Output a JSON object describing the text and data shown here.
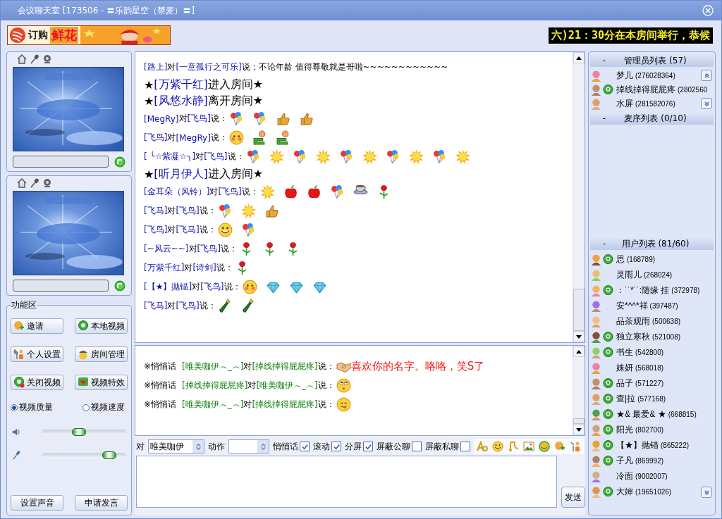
{
  "window": {
    "title": "会议聊天室 [173506 - 〓乐韵星空（禁麦）〓]"
  },
  "banner": {
    "text": "订购",
    "highlight": "鲜花"
  },
  "marquee": {
    "text": "六)21：30分在本房间举行，恭候"
  },
  "function_area": {
    "title": "功能区",
    "buttons": [
      {
        "label": "邀请",
        "kind": "invite"
      },
      {
        "label": "本地视频",
        "kind": "local_video"
      },
      {
        "label": "个人设置",
        "kind": "settings"
      },
      {
        "label": "房间管理",
        "kind": "room"
      },
      {
        "label": "关闭视频",
        "kind": "close_video"
      },
      {
        "label": "视频特效",
        "kind": "effect"
      }
    ],
    "radios": [
      {
        "label": "视频质量",
        "selected": true
      },
      {
        "label": "视频速度",
        "selected": false
      }
    ],
    "sliders": [
      {
        "kind": "speaker",
        "level": 0.42
      },
      {
        "kind": "mic",
        "level": 0.86
      }
    ],
    "bottom_buttons": [
      "设置声音",
      "申请发言"
    ]
  },
  "public_chat": [
    {
      "kind": "say",
      "from": "[路上]",
      "joiner": "对",
      "to": "[一意孤行之可乐]",
      "verb": "说：",
      "text": "不论年龄  值得尊敬就是哥啦~~~~~~~~~~~~"
    },
    {
      "kind": "event",
      "prefix": "★",
      "name": "[万紫千红]",
      "suffix": "进入房间★"
    },
    {
      "kind": "event",
      "prefix": "★",
      "name": "[风悠水静]",
      "suffix": "离开房间★"
    },
    {
      "kind": "say",
      "from": "[MegRy]",
      "joiner": "对",
      "to": "[飞鸟]",
      "verb": "说：",
      "emotes": [
        {
          "kind": "balloon"
        },
        {
          "kind": "balloon"
        },
        {
          "kind": "thumb"
        },
        {
          "kind": "thumb"
        }
      ]
    },
    {
      "kind": "say",
      "from": "[飞鸟]",
      "joiner": "对",
      "to": "[MegRy]",
      "verb": "说：",
      "emotes": [
        {
          "kind": "blush"
        },
        {
          "kind": "hug"
        },
        {
          "kind": "hug"
        }
      ]
    },
    {
      "kind": "say",
      "from": "[ ╰☆紫凝☆╮]",
      "joiner": "对",
      "to": "[飞鸟]",
      "verb": "说：",
      "emotes": [
        {
          "kind": "balloon"
        },
        {
          "kind": "sun"
        },
        {
          "kind": "balloon"
        },
        {
          "kind": "sun"
        },
        {
          "kind": "balloon"
        },
        {
          "kind": "sun"
        },
        {
          "kind": "balloon"
        },
        {
          "kind": "sun"
        },
        {
          "kind": "balloon"
        },
        {
          "kind": "sun"
        }
      ]
    },
    {
      "kind": "event",
      "prefix": "★",
      "name": "[听月伊人]",
      "suffix": "进入房间★"
    },
    {
      "kind": "say",
      "from": "[金耳朵（风铃）]",
      "joiner": "对",
      "to": "[飞鸟]",
      "verb": "说：",
      "emotes": [
        {
          "kind": "sun"
        },
        {
          "kind": "apple"
        },
        {
          "kind": "apple"
        },
        {
          "kind": "balloon"
        },
        {
          "kind": "tea"
        },
        {
          "kind": "rose"
        }
      ]
    },
    {
      "kind": "say",
      "from": "[飞马]",
      "joiner": "对",
      "to": "[飞鸟]",
      "verb": "说：",
      "emotes": [
        {
          "kind": "balloon"
        },
        {
          "kind": "sun"
        },
        {
          "kind": "thumb"
        }
      ]
    },
    {
      "kind": "say",
      "from": "[飞鸟]",
      "joiner": "对",
      "to": "[飞马]",
      "verb": "说：",
      "emotes": [
        {
          "kind": "smile"
        },
        {
          "kind": "balloon"
        }
      ]
    },
    {
      "kind": "say",
      "from": "[~风云~~]",
      "joiner": "对",
      "to": "[飞鸟]",
      "verb": "说：",
      "emotes": [
        {
          "kind": "rose"
        },
        {
          "kind": "rose"
        },
        {
          "kind": "rose"
        }
      ]
    },
    {
      "kind": "say",
      "from": "[万紫千红]",
      "joiner": "对",
      "to": "[诗剑]",
      "verb": "说：",
      "emotes": [
        {
          "kind": "rose"
        }
      ]
    },
    {
      "kind": "say",
      "from": "[【★】抛锚]",
      "joiner": "对",
      "to": "[飞鸟]",
      "verb": "说：",
      "emotes": [
        {
          "kind": "blush"
        },
        {
          "kind": "diamond"
        },
        {
          "kind": "diamond"
        },
        {
          "kind": "diamond"
        }
      ]
    },
    {
      "kind": "say",
      "from": "[飞马]",
      "joiner": "对",
      "to": "[飞鸟]",
      "verb": "说：",
      "emotes": [
        {
          "kind": "bottle"
        },
        {
          "kind": "bottle"
        }
      ]
    }
  ],
  "private_chat": [
    {
      "kind": "whisper",
      "prefix": "※悄悄话",
      "from": "[唯美咖伊︵_︵]",
      "joiner": "对",
      "to": "[掉线掉得屁屁疼]",
      "verb": "说：",
      "emotes": [
        {
          "kind": "handshake"
        }
      ],
      "text": "喜欢你的名字。咯咯，笑S了"
    },
    {
      "kind": "whisper",
      "prefix": "※悄悄话",
      "from": "[掉线掉得屁屁疼]",
      "joiner": "对",
      "to": "[唯美咖伊︵_︵]",
      "verb": "说：",
      "emotes": [
        {
          "kind": "eyeroll"
        }
      ]
    },
    {
      "kind": "whisper",
      "prefix": "※悄悄话",
      "from": "[唯美咖伊︵_︵]",
      "joiner": "对",
      "to": "[掉线掉得屁屁疼]",
      "verb": "说：",
      "emotes": [
        {
          "kind": "tongue"
        }
      ]
    }
  ],
  "input_bar": {
    "to_label": "对",
    "to_value": "唯美咖伊",
    "action_label": "动作",
    "options": [
      {
        "label": "悄悄话",
        "checked": true
      },
      {
        "label": "滚动",
        "checked": true
      },
      {
        "label": "分屏",
        "checked": true
      },
      {
        "label": "屏蔽公聊",
        "checked": false
      },
      {
        "label": "屏蔽私聊",
        "checked": false
      }
    ],
    "send": "发送"
  },
  "admin_list": {
    "toggle": "-",
    "title": "管理员列表 (57)",
    "users": [
      {
        "name": "梦儿",
        "id": "(276028364)",
        "camera": false
      },
      {
        "name": "掉线掉得屁屁疼",
        "id": "(2802560",
        "camera": true
      },
      {
        "name": "水屏",
        "id": "(281582076)",
        "camera": false
      }
    ]
  },
  "mic_queue": {
    "toggle": "-",
    "title": "麦序列表 (0/10)"
  },
  "user_list": {
    "toggle": "-",
    "title": "用户列表 (81/60)",
    "users": [
      {
        "name": "思",
        "id": "(168789)",
        "camera": true
      },
      {
        "name": "灵雨儿",
        "id": "(268024)",
        "camera": false
      },
      {
        "name": "：˙˙*˙˙:随缘 挂",
        "id": "(372978)",
        "camera": true
      },
      {
        "name": "安*^^*祥",
        "id": "(397487)",
        "camera": false
      },
      {
        "name": "品茶观雨",
        "id": "(500638)",
        "camera": false
      },
      {
        "name": "独立寒秋",
        "id": "(521008)",
        "camera": true
      },
      {
        "name": "书生",
        "id": "(542800)",
        "camera": true
      },
      {
        "name": "姝妍",
        "id": "(568018)",
        "camera": false
      },
      {
        "name": "品子",
        "id": "(571227)",
        "camera": true
      },
      {
        "name": "查|拉",
        "id": "(577168)",
        "camera": true
      },
      {
        "name": "★& 最爱& ★",
        "id": "(668815)",
        "camera": true
      },
      {
        "name": "阳光",
        "id": "(802700)",
        "camera": true
      },
      {
        "name": "【★】抛锚",
        "id": "(865222)",
        "camera": true
      },
      {
        "name": "子凡",
        "id": "(869992)",
        "camera": true
      },
      {
        "name": "冷面",
        "id": "(9002007)",
        "camera": false
      },
      {
        "name": "大婶",
        "id": "(19651026)",
        "camera": true
      }
    ]
  }
}
